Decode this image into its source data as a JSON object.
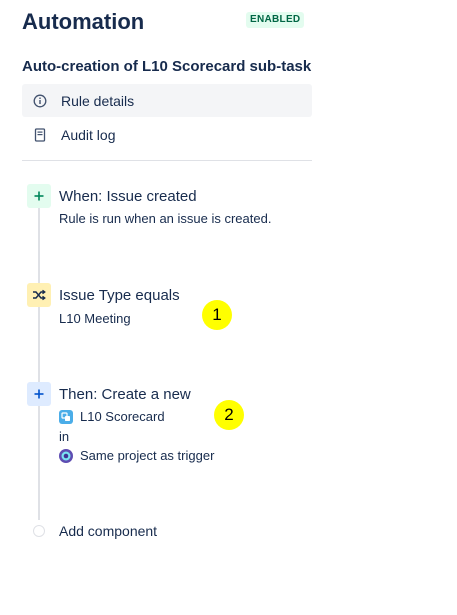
{
  "header": {
    "title": "Automation",
    "status_badge": "ENABLED"
  },
  "rule": {
    "name": "Auto-creation of L10 Scorecard sub-task"
  },
  "nav": {
    "items": [
      {
        "label": "Rule details",
        "icon": "info-icon",
        "active": true
      },
      {
        "label": "Audit log",
        "icon": "document-icon",
        "active": false
      }
    ]
  },
  "steps": [
    {
      "kind": "trigger",
      "icon": "plus-icon",
      "title": "When: Issue created",
      "subtitle": "Rule is run when an issue is created."
    },
    {
      "kind": "condition",
      "icon": "shuffle-icon",
      "title": "Issue Type equals",
      "subtitle": "L10 Meeting",
      "callout": "1"
    },
    {
      "kind": "action",
      "icon": "plus-icon",
      "title": "Then: Create a new",
      "issue_type": "L10 Scorecard",
      "connector": "in",
      "project": "Same project as trigger",
      "callout": "2"
    }
  ],
  "add_component": {
    "label": "Add component"
  },
  "colors": {
    "trigger_bg": "#e3fcef",
    "trigger_fg": "#00875a",
    "condition_bg": "#fff0b3",
    "condition_fg": "#172b4d",
    "action_bg": "#deebff",
    "action_fg": "#0052cc",
    "callout": "#ffff00"
  }
}
